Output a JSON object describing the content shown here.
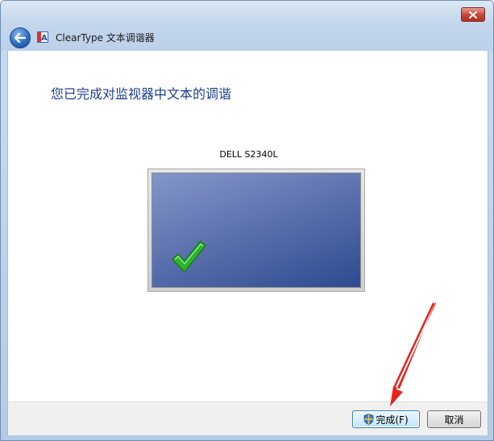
{
  "window": {
    "title": "ClearType 文本调谐器",
    "close_icon": "close-icon",
    "back_icon": "back-arrow-icon",
    "app_icon": "cleartype-icon"
  },
  "main": {
    "heading": "您已完成对监视器中文本的调谐",
    "monitor_name": "DELL S2340L",
    "status_icon": "checkmark-icon"
  },
  "footer": {
    "finish_label": "完成(F)",
    "cancel_label": "取消",
    "shield_icon": "uac-shield-icon"
  },
  "colors": {
    "heading": "#1e3f8c",
    "annotation_arrow": "#e8231b",
    "checkmark": "#2db42d",
    "screen": "#3d5a9c"
  }
}
